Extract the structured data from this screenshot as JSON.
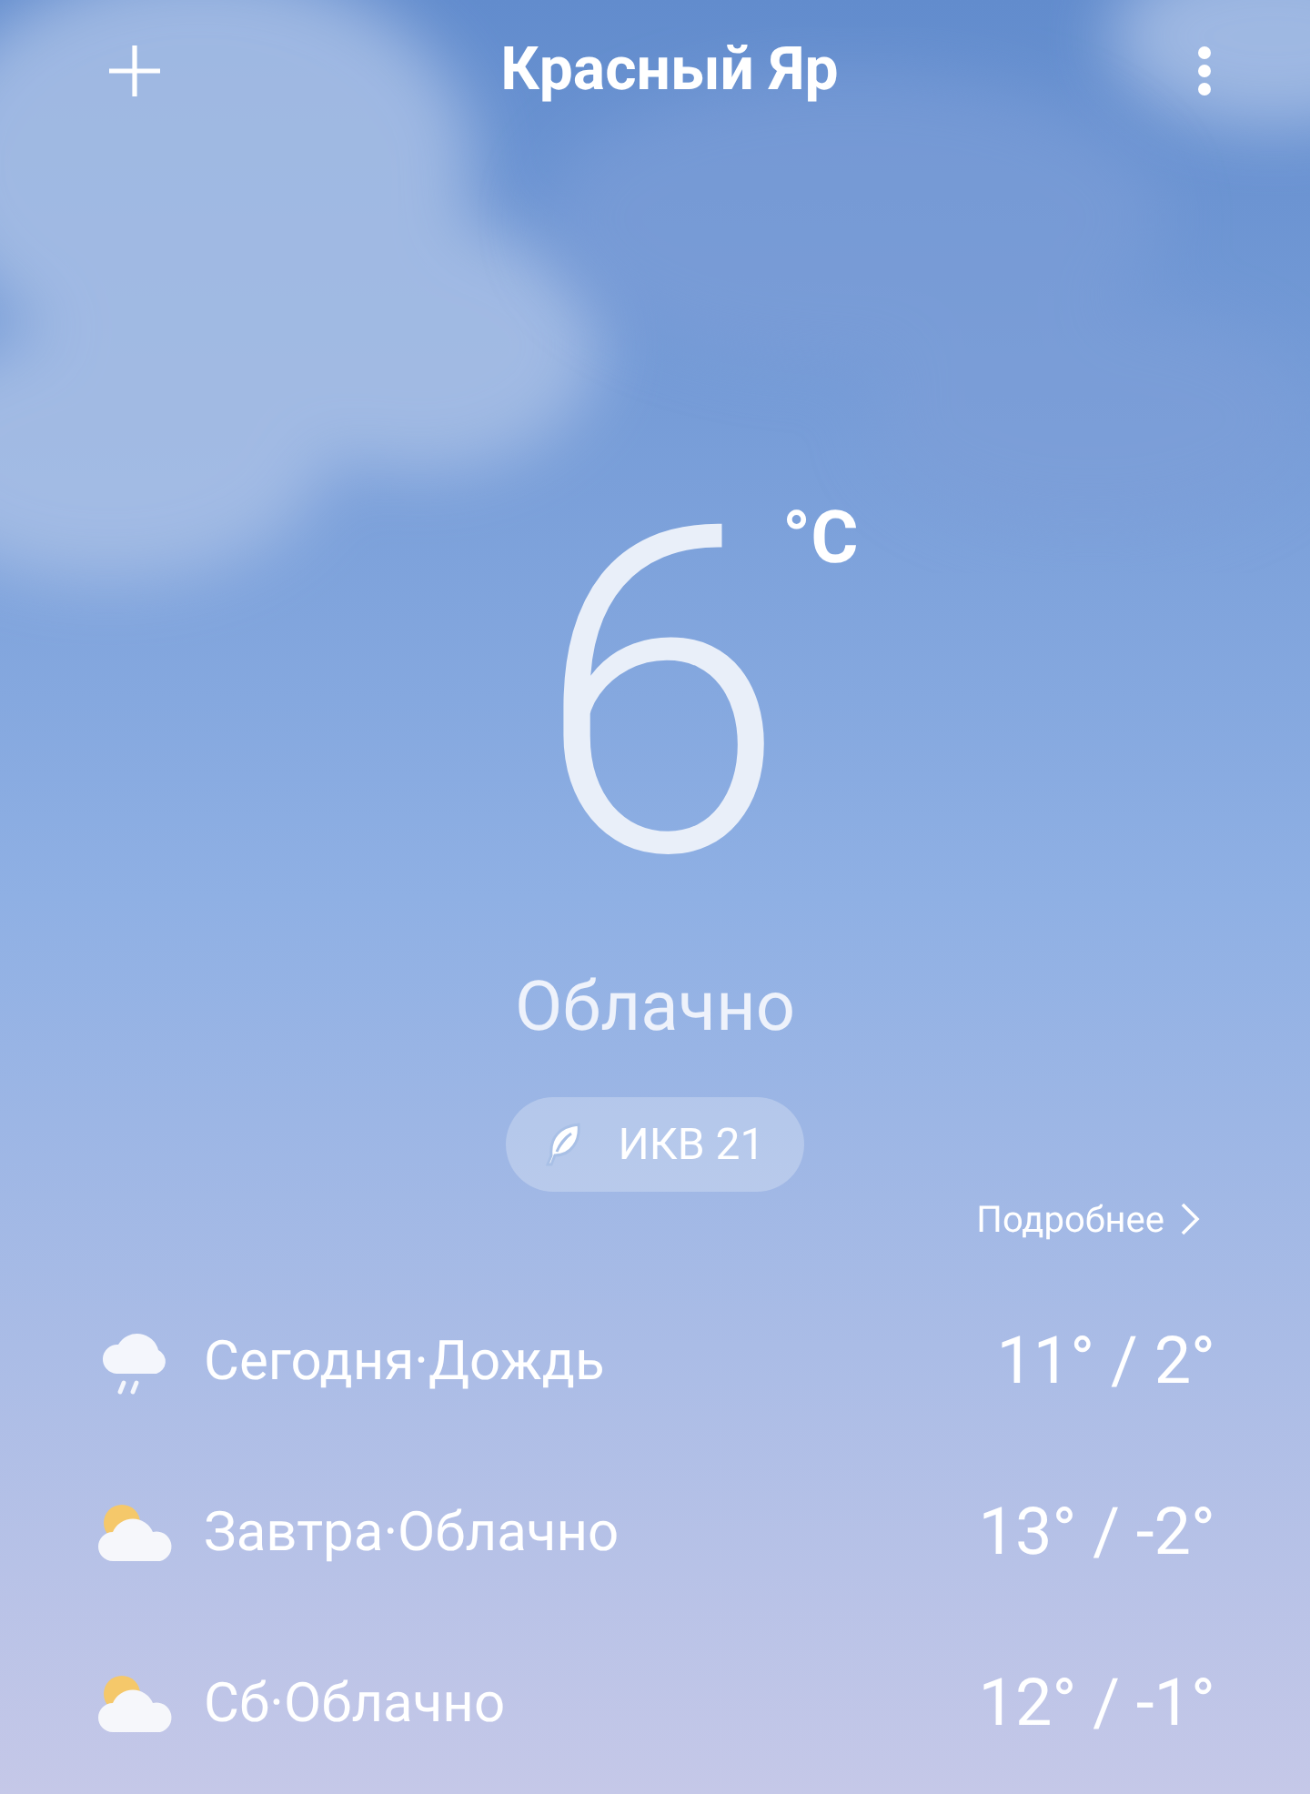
{
  "header": {
    "title": "Красный Яр"
  },
  "current": {
    "temperature": "6",
    "unit": "°C",
    "condition": "Облачно"
  },
  "air_quality": {
    "label": "ИКВ 21"
  },
  "details_link": {
    "label": "Подробнее"
  },
  "forecast": [
    {
      "kind": "rain",
      "label": "Сегодня·Дождь",
      "temps": "11° / 2°"
    },
    {
      "kind": "partly_cloudy",
      "label": "Завтра·Облачно",
      "temps": "13° / -2°"
    },
    {
      "kind": "partly_cloudy",
      "label": "Сб·Облачно",
      "temps": "12° / -1°"
    }
  ]
}
